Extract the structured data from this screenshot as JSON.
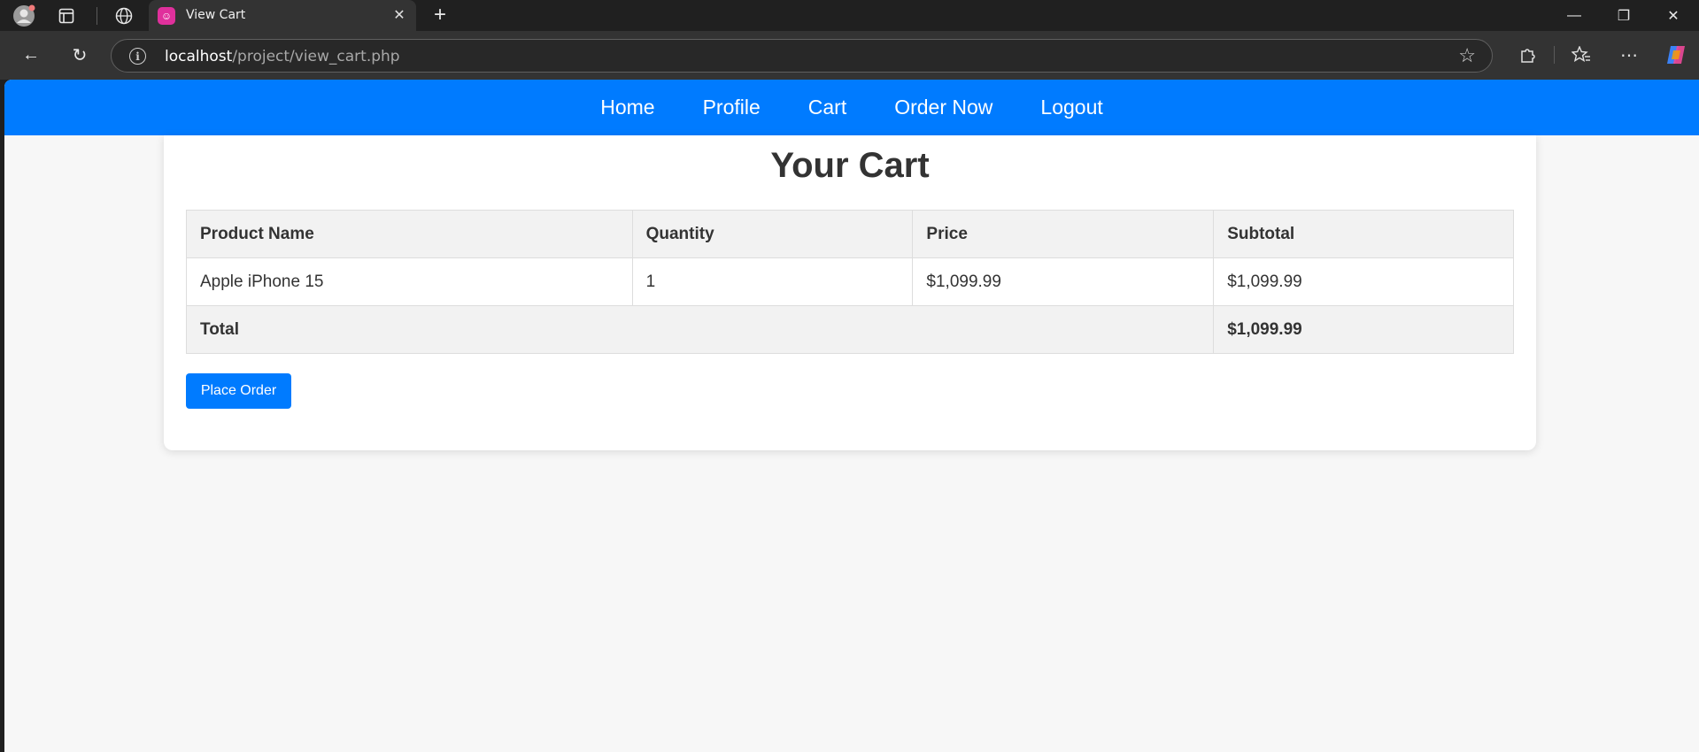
{
  "browser": {
    "tab_title": "View Cart",
    "tab_favicon": "☺",
    "url_host": "localhost",
    "url_path": "/project/view_cart.php"
  },
  "nav": {
    "items": [
      "Home",
      "Profile",
      "Cart",
      "Order Now",
      "Logout"
    ]
  },
  "cart": {
    "title": "Your Cart",
    "headers": [
      "Product Name",
      "Quantity",
      "Price",
      "Subtotal"
    ],
    "rows": [
      [
        "Apple iPhone 15",
        "1",
        "$1,099.99",
        "$1,099.99"
      ]
    ],
    "total_label": "Total",
    "total_value": "$1,099.99",
    "button_label": "Place Order"
  },
  "colors": {
    "accent": "#007bff",
    "chrome_bg": "#202020"
  }
}
